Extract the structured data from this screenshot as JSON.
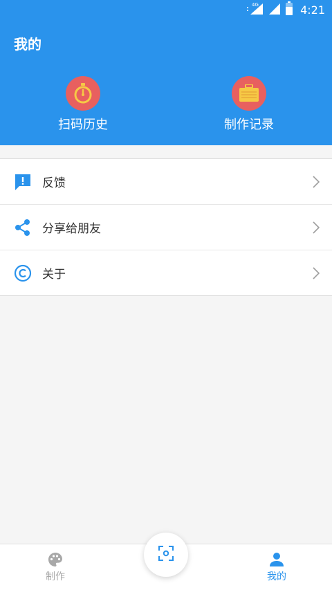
{
  "status_bar": {
    "network": "4G",
    "time": "4:21",
    "icons": [
      "signal-icon",
      "signal-icon",
      "battery-icon"
    ]
  },
  "header": {
    "title": "我的",
    "background_color": "#2a93ec"
  },
  "quick_actions": [
    {
      "label": "扫码历史",
      "icon": "stopwatch-icon",
      "icon_bg": "#e8605f"
    },
    {
      "label": "制作记录",
      "icon": "briefcase-icon",
      "icon_bg": "#e8605f"
    }
  ],
  "menu": [
    {
      "label": "反馈",
      "icon": "feedback-icon"
    },
    {
      "label": "分享给朋友",
      "icon": "share-icon"
    },
    {
      "label": "关于",
      "icon": "copyright-icon"
    }
  ],
  "bottom_nav": {
    "items": [
      {
        "label": "制作",
        "icon": "palette-icon",
        "active": false
      },
      {
        "label": "我的",
        "icon": "person-icon",
        "active": true
      }
    ],
    "center_button_icon": "scan-icon"
  },
  "colors": {
    "primary": "#2a93ec",
    "accent": "#e8605f",
    "inactive": "#a8a8a8"
  }
}
